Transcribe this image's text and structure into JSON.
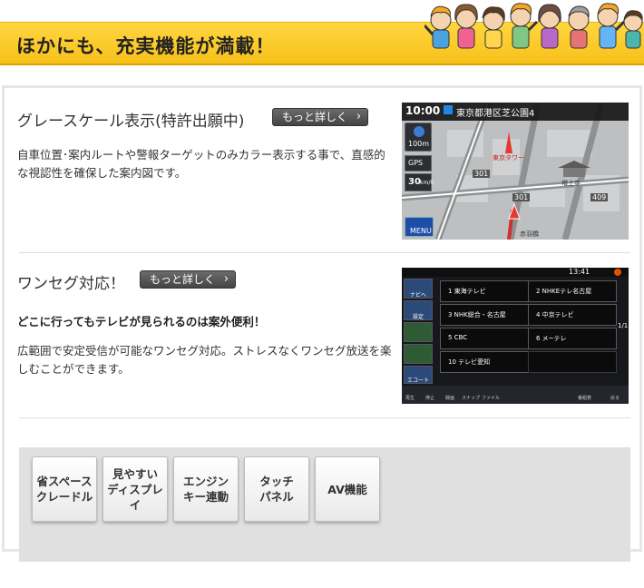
{
  "banner": {
    "title": "ほかにも、充実機能が満載！"
  },
  "sections": [
    {
      "title": "グレースケール表示(特許出願中)",
      "more_label": "もっと詳しく",
      "description_lines": [
        "自車位置･案内ルートや警報ターゲットのみカラー表示する事で、直感的",
        "な視認性を確保した案内図です。"
      ],
      "screenshot": {
        "clock": "10:00",
        "address": "東京都港区芝公園4",
        "scale": "100m",
        "gps": "GPS",
        "speed": "30",
        "speed_unit": "km/h",
        "menu": "MENU",
        "road_labels": [
          "301",
          "301",
          "409"
        ],
        "place_labels": [
          "東京タワー",
          "増上寺",
          "赤羽橋"
        ]
      }
    },
    {
      "title": "ワンセグ対応！",
      "more_label": "もっと詳しく",
      "sub_heading": "どこに行ってもテレビが見られるのは案外便利！",
      "description_lines": [
        "広範囲で安定受信が可能なワンセグ対応。ストレスなくワンセグ放送を楽",
        "しむことができます。"
      ],
      "screenshot": {
        "clock": "13:41",
        "channels": [
          "1 東海テレビ",
          "2 NHKEテレ名古屋",
          "3 NHK総合・名古屋",
          "4 中京テレビ",
          "5 CBC",
          "6 メ~テレ",
          "10 テレビ愛知"
        ],
        "left_labels": [
          "ナビへ",
          "設定",
          "",
          "",
          "エコート"
        ],
        "bottom_labels": [
          "再生",
          "停止",
          "録画",
          "スナップ",
          "ファイル",
          "番組表",
          "戻る"
        ],
        "page": "1/1"
      }
    }
  ],
  "feature_buttons": [
    {
      "line1": "省スペース",
      "line2": "クレードル"
    },
    {
      "line1": "見やすい",
      "line2": "ディスプレイ"
    },
    {
      "line1": "エンジン",
      "line2": "キー連動"
    },
    {
      "line1": "タッチ",
      "line2": "パネル"
    },
    {
      "line1": "AV機能",
      "line2": ""
    }
  ],
  "colors": {
    "banner": "#f7c11a",
    "button_dark": "#4a4a4a",
    "tray": "#e0e0e0"
  }
}
